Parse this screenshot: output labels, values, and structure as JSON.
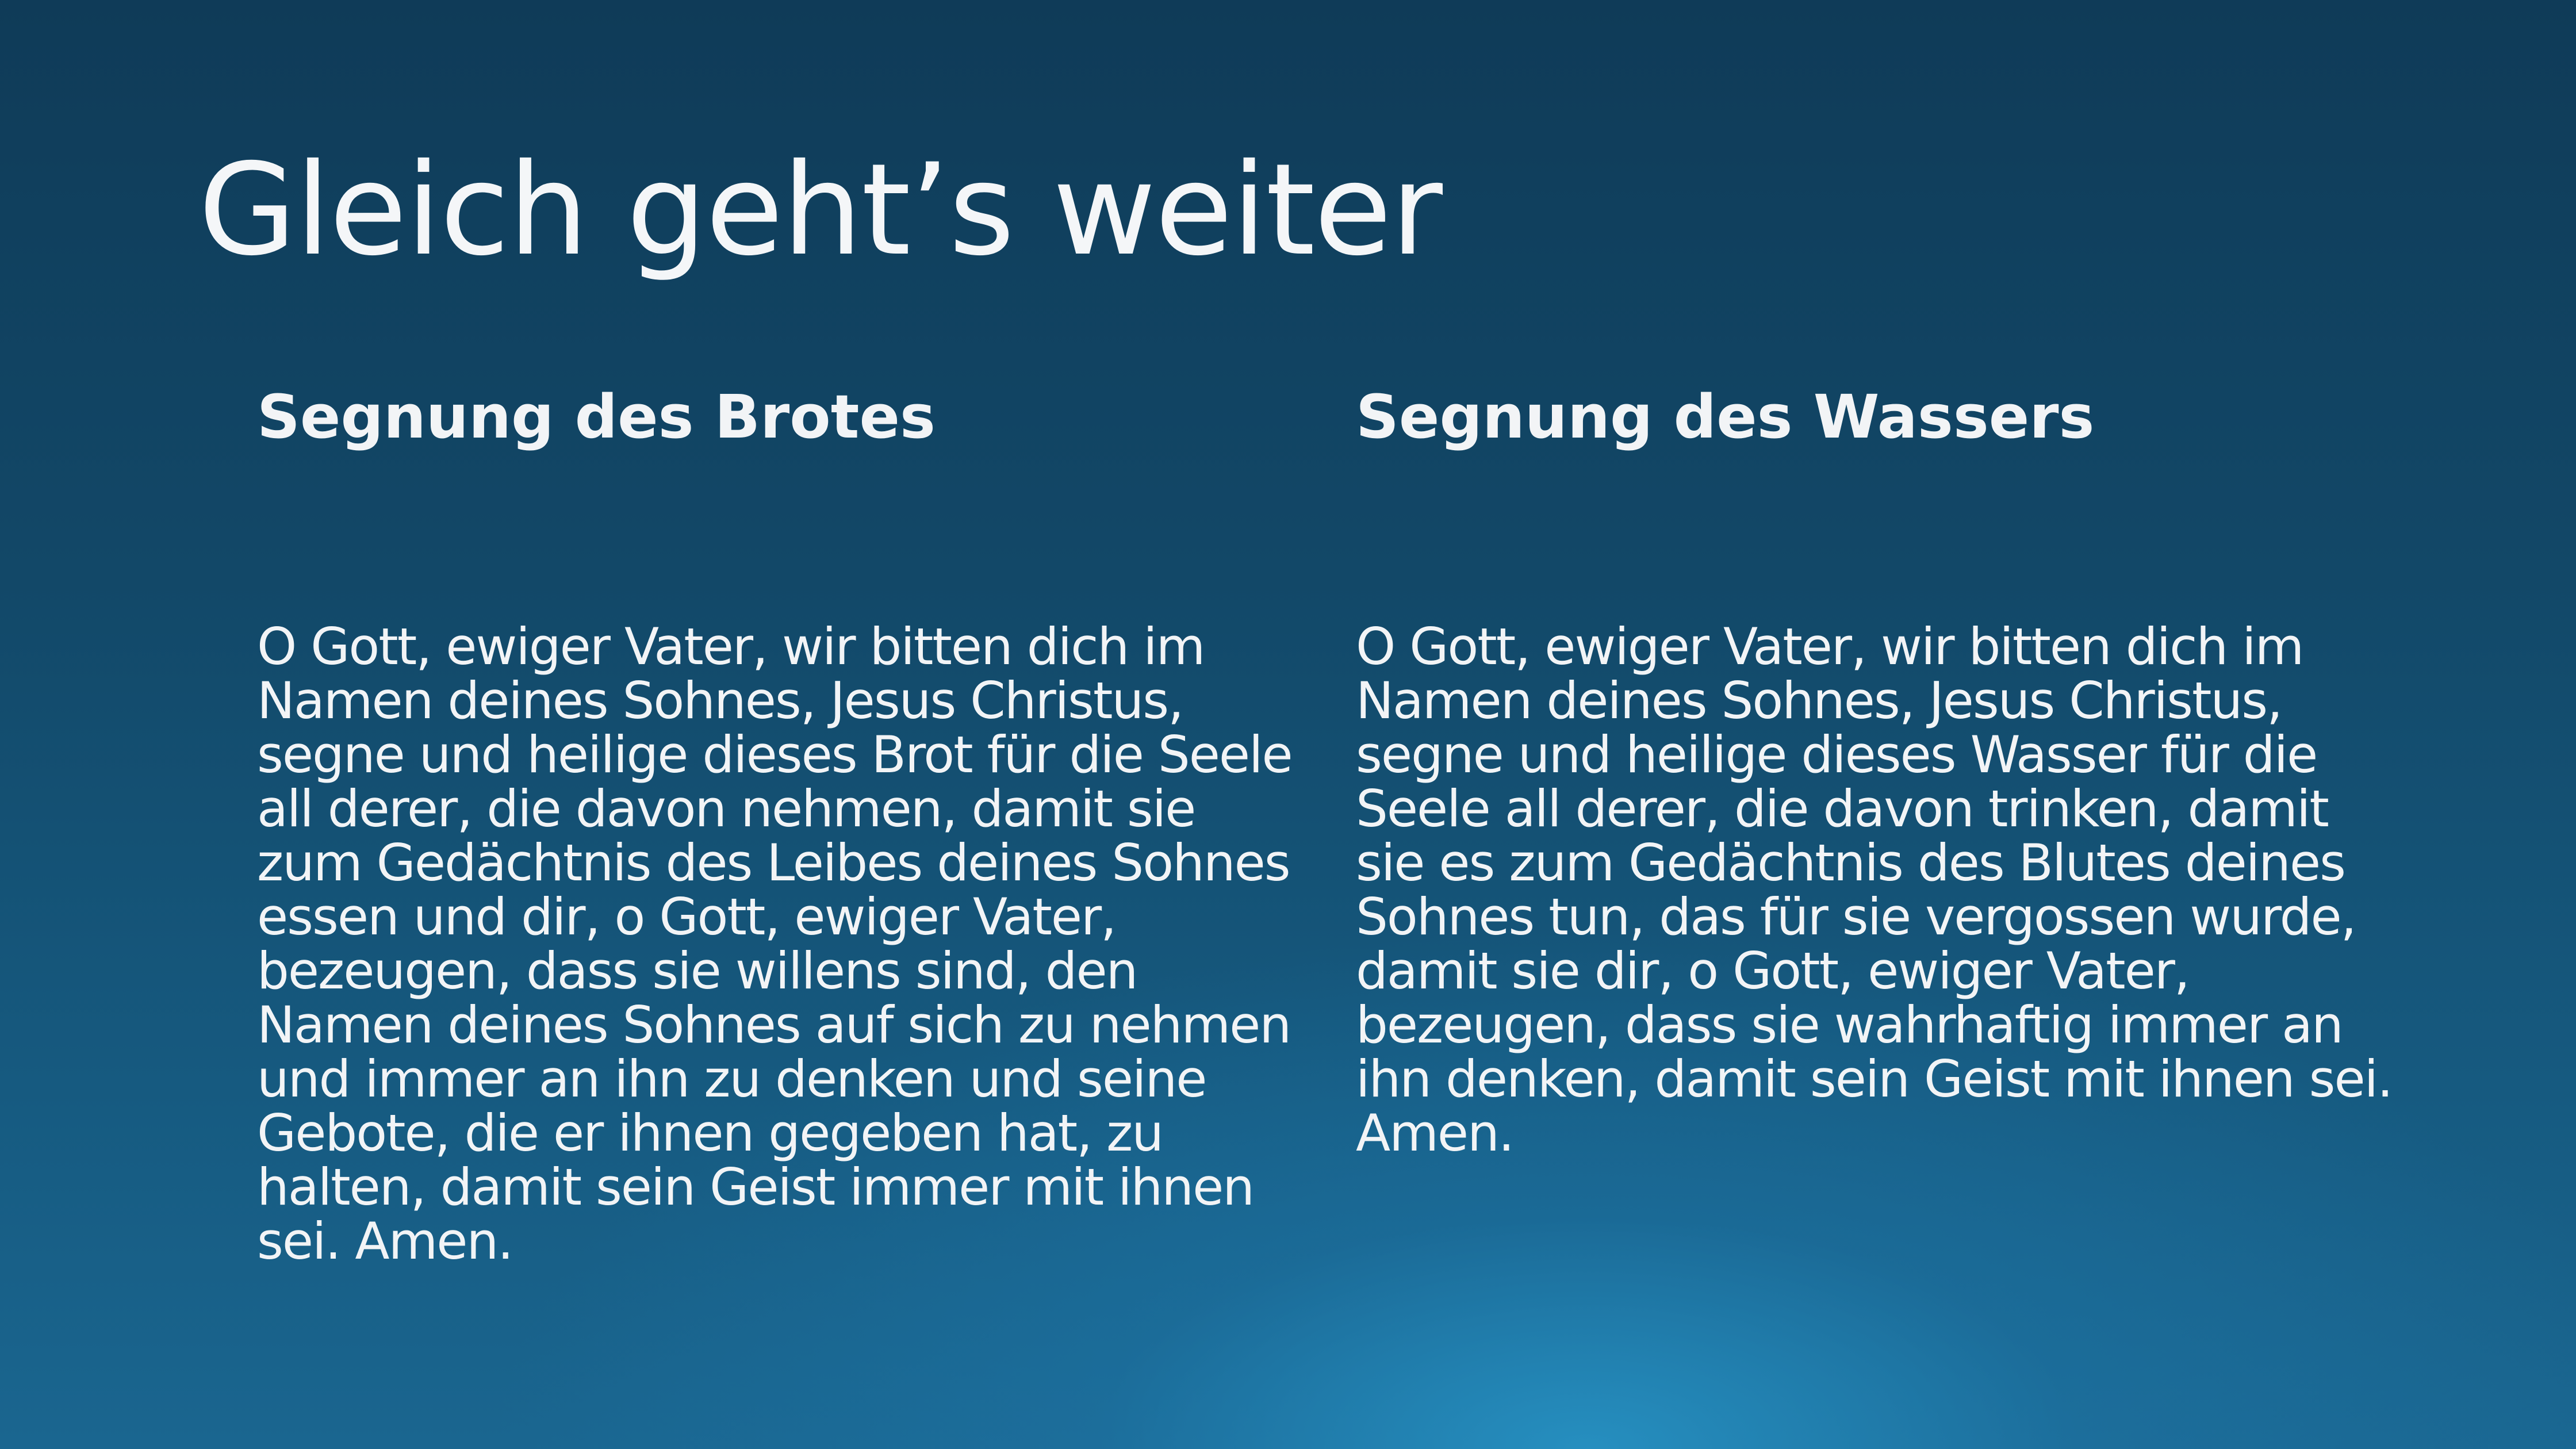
{
  "slide": {
    "title": "Gleich geht’s weiter",
    "left_column": {
      "heading": "Segnung des Brotes",
      "body": "O Gott, ewiger Vater, wir bitten dich im Namen deines Sohnes, Jesus Christus, segne und heilige dieses Brot für die Seele all derer, die davon nehmen, damit sie zum Gedächtnis des Leibes deines Sohnes essen und dir, o Gott, ewiger Vater, bezeugen, dass sie willens sind, den Namen deines Sohnes auf sich zu nehmen und immer an ihn zu denken und seine Gebote, die er ihnen gegeben hat, zu halten, damit sein Geist immer mit ihnen sei. Amen."
    },
    "right_column": {
      "heading": "Segnung des Wassers",
      "body": "O Gott, ewiger Vater, wir bitten dich im Namen deines Sohnes, Jesus Christus, segne und heilige dieses Wasser für die Seele all derer, die davon trinken, damit sie es zum Gedächtnis des Blutes deines Sohnes tun, das für sie vergossen wurde, damit sie dir, o Gott, ewiger Vater, bezeugen, dass sie wahrhaftig immer an ihn denken, damit sein Geist mit ihnen sei. Amen."
    }
  },
  "colors": {
    "background_top": "#0f3b58",
    "background_bottom": "#1a6690",
    "glow": "#2896c8",
    "text": "#f2f4f6"
  }
}
